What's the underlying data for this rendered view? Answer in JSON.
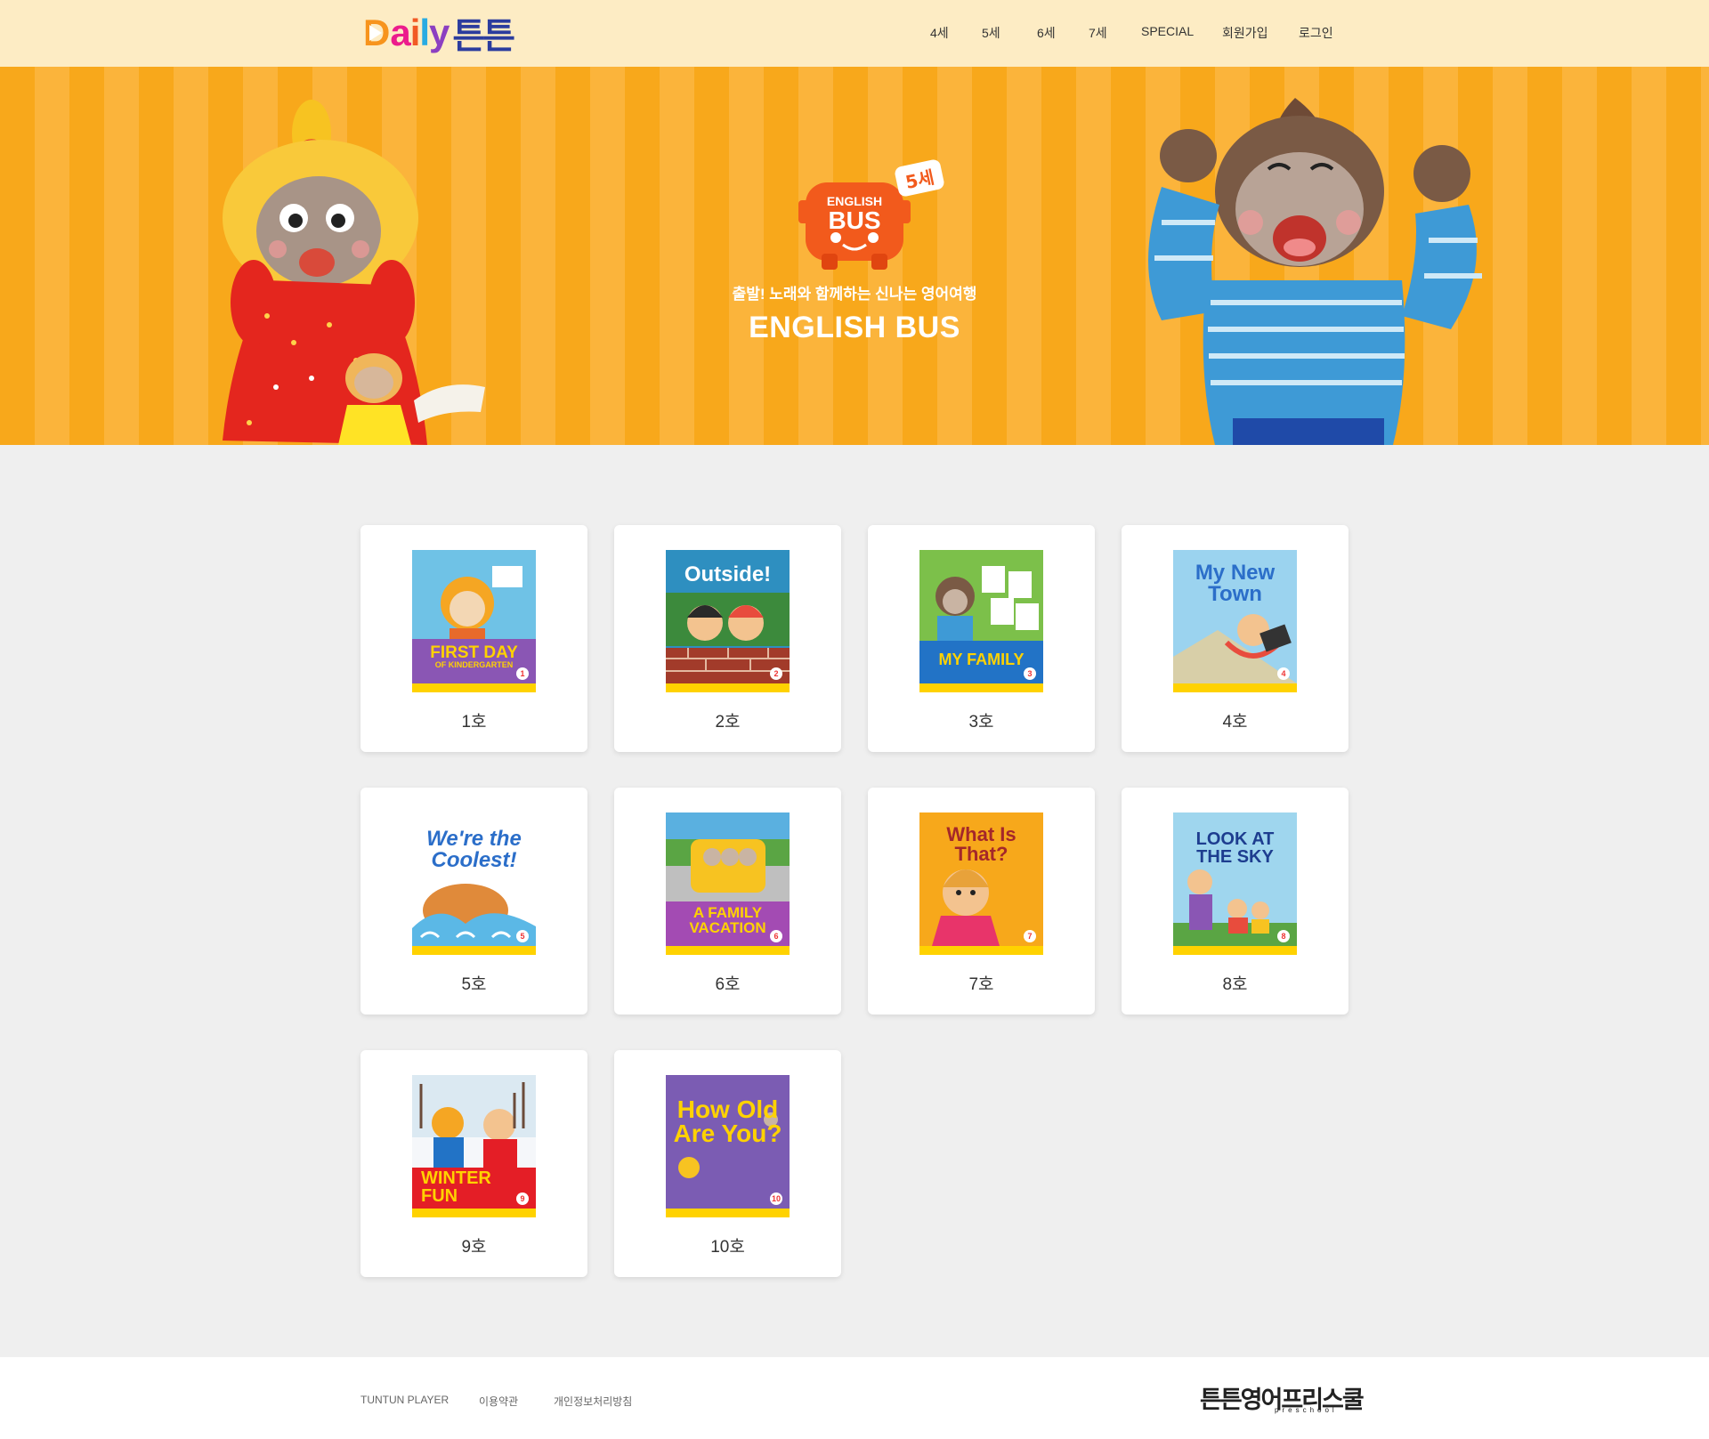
{
  "header": {
    "logo": {
      "letters": [
        "D",
        "a",
        "i",
        "l",
        "y"
      ],
      "letter_colors": [
        "#f7941d",
        "#ec1c8c",
        "#f15a24",
        "#29abe2",
        "#8c3fc1"
      ],
      "suffix": "튼튼"
    },
    "nav": [
      "4세",
      "5세",
      "6세",
      "7세",
      "SPECIAL",
      "회원가입",
      "로그인"
    ]
  },
  "banner": {
    "bus_logo": {
      "line1": "ENGLISH",
      "line2": "BUS",
      "age": "5세"
    },
    "subtitle": "출발! 노래와 함께하는 신나는 영어여행",
    "title": "ENGLISH BUS"
  },
  "books": [
    {
      "label": "1호",
      "cover_title": "FIRST DAY",
      "cover_sub": "OF KINDERGARTEN",
      "num": "1",
      "colors": {
        "top": "#6fc2e6",
        "panel": "#8a56b4",
        "text": "#ffd200"
      }
    },
    {
      "label": "2호",
      "cover_title": "Outside!",
      "cover_sub": "",
      "num": "2",
      "colors": {
        "top": "#2e8fc0",
        "panel": "#a23b2a",
        "text": "#ffffff"
      }
    },
    {
      "label": "3호",
      "cover_title": "MY FAMILY",
      "cover_sub": "",
      "num": "3",
      "colors": {
        "top": "#7cc04a",
        "panel": "#2273c6",
        "text": "#ffd200"
      }
    },
    {
      "label": "4호",
      "cover_title": "My New Town",
      "cover_sub": "",
      "num": "4",
      "colors": {
        "top": "#9bd3ef",
        "panel": "#bfe3f2",
        "text": "#2b6ec9"
      }
    },
    {
      "label": "5호",
      "cover_title": "We're the Coolest!",
      "cover_sub": "",
      "num": "5",
      "colors": {
        "top": "#ffffff",
        "panel": "#ffffff",
        "text": "#2b6ec9"
      }
    },
    {
      "label": "6호",
      "cover_title": "A FAMILY VACATION",
      "cover_sub": "",
      "num": "6",
      "colors": {
        "top": "#5ab0e0",
        "panel": "#a34bb3",
        "text": "#ffd200"
      }
    },
    {
      "label": "7호",
      "cover_title": "What Is That?",
      "cover_sub": "",
      "num": "7",
      "colors": {
        "top": "#f7a81b",
        "panel": "#f7a81b",
        "text": "#a4272a"
      }
    },
    {
      "label": "8호",
      "cover_title": "LOOK AT THE SKY",
      "cover_sub": "",
      "num": "8",
      "colors": {
        "top": "#9fd6ee",
        "panel": "#9fd6ee",
        "text": "#1d3d8f"
      }
    },
    {
      "label": "9호",
      "cover_title": "WINTER FUN",
      "cover_sub": "",
      "num": "9",
      "colors": {
        "top": "#dbe9f2",
        "panel": "#e41e26",
        "text": "#ffd200"
      }
    },
    {
      "label": "10호",
      "cover_title": "How Old Are You?",
      "cover_sub": "",
      "num": "10",
      "colors": {
        "top": "#7b5cb3",
        "panel": "#7b5cb3",
        "text": "#ffd200"
      }
    }
  ],
  "footer": {
    "links": [
      "TUNTUN PLAYER",
      "이용약관",
      "개인정보처리방침"
    ],
    "logo_main": "튼튼영어프리스쿨",
    "logo_sub": "preschool"
  }
}
